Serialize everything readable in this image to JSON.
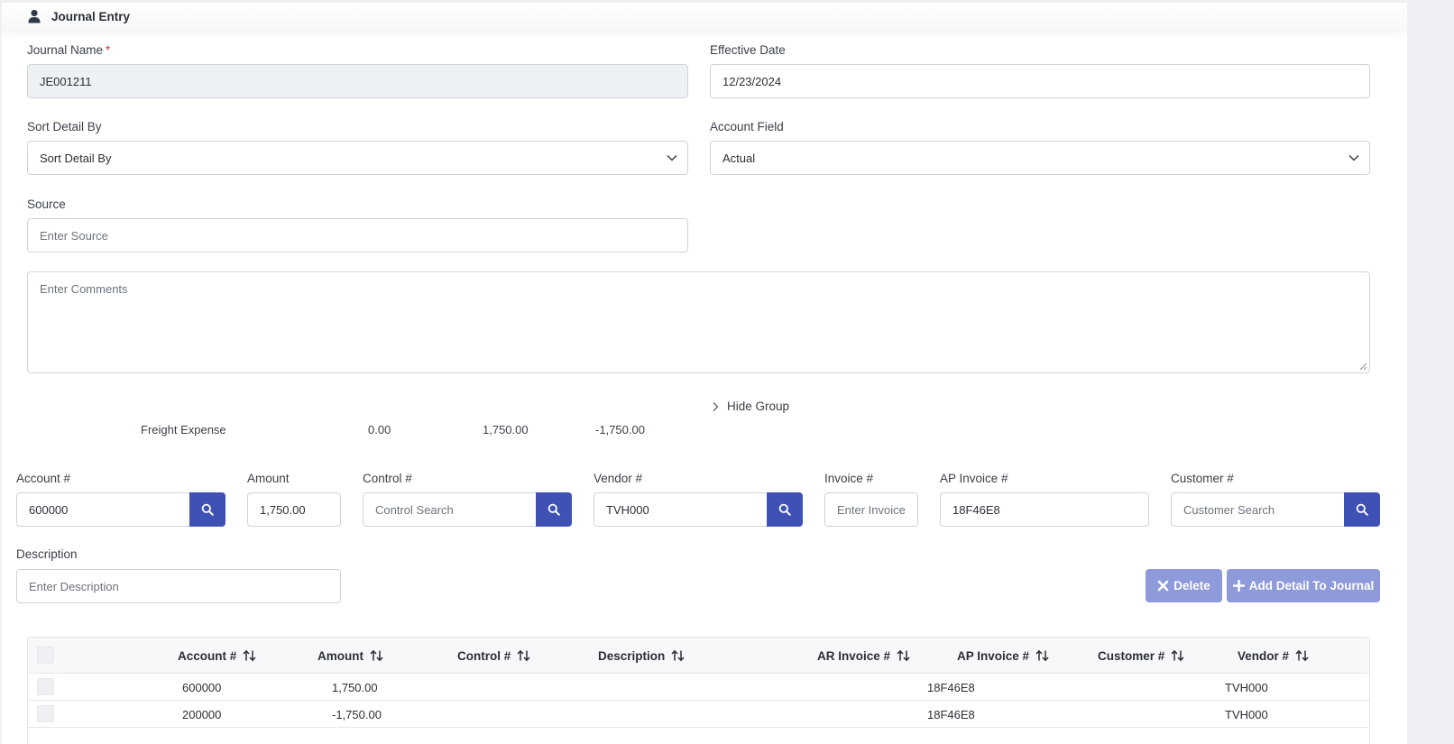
{
  "header": {
    "title": "Journal Entry",
    "icon": "user-icon"
  },
  "form": {
    "journal_name": {
      "label": "Journal Name",
      "required_mark": "*",
      "value": "JE001211"
    },
    "effective_date": {
      "label": "Effective Date",
      "value": "12/23/2024"
    },
    "sort_detail_by": {
      "label": "Sort Detail By",
      "placeholder": "Sort Detail By"
    },
    "account_field": {
      "label": "Account Field",
      "value": "Actual"
    },
    "source": {
      "label": "Source",
      "placeholder": "Enter Source"
    },
    "comments": {
      "placeholder": "Enter Comments"
    }
  },
  "group": {
    "toggle_label": "Hide Group",
    "summary": {
      "name": "Freight Expense",
      "col1": "0.00",
      "col2": "1,750.00",
      "col3": "-1,750.00"
    }
  },
  "detail": {
    "account": {
      "label": "Account #",
      "value": "600000"
    },
    "amount": {
      "label": "Amount",
      "value": "1,750.00"
    },
    "control": {
      "label": "Control #",
      "placeholder": "Control Search"
    },
    "vendor": {
      "label": "Vendor #",
      "value": "TVH000"
    },
    "invoice": {
      "label": "Invoice #",
      "placeholder": "Enter Invoice"
    },
    "ap_invoice": {
      "label": "AP Invoice #",
      "value": "18F46E8"
    },
    "customer": {
      "label": "Customer #",
      "placeholder": "Customer Search"
    },
    "description": {
      "label": "Description",
      "placeholder": "Enter Description"
    }
  },
  "buttons": {
    "delete": "Delete",
    "add_detail": "Add Detail To Journal"
  },
  "table": {
    "columns": [
      "Account #",
      "Amount",
      "Control #",
      "Description",
      "AR Invoice #",
      "AP Invoice #",
      "Customer #",
      "Vendor #"
    ],
    "rows": [
      {
        "account": "600000",
        "amount": "1,750.00",
        "control": "",
        "description": "",
        "ar_invoice": "",
        "ap_invoice": "18F46E8",
        "customer": "",
        "vendor": "TVH000"
      },
      {
        "account": "200000",
        "amount": "-1,750.00",
        "control": "",
        "description": "",
        "ar_invoice": "",
        "ap_invoice": "18F46E8",
        "customer": "",
        "vendor": "TVH000"
      }
    ]
  },
  "colors": {
    "primary": "#3f51b5",
    "button_disabled": "#8e9ad9",
    "required": "#d0303a"
  }
}
